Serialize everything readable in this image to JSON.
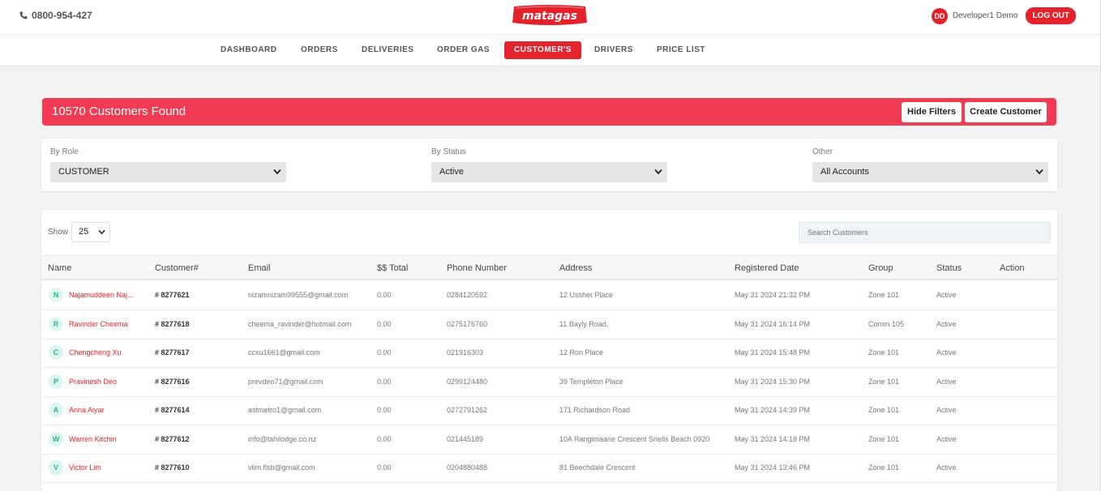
{
  "header": {
    "phone": "0800-954-427",
    "logo_text": "matagas",
    "user_initials": "DD",
    "user_name": "Developer1 Demo",
    "logout_label": "LOG OUT"
  },
  "nav": {
    "items": [
      "DASHBOARD",
      "ORDERS",
      "DELIVERIES",
      "ORDER GAS",
      "CUSTOMER'S",
      "DRIVERS",
      "PRICE LIST"
    ],
    "active": "CUSTOMER'S"
  },
  "banner": {
    "title": "10570 Customers Found",
    "hide_filters_label": "Hide Filters",
    "create_customer_label": "Create Customer"
  },
  "filters": {
    "role": {
      "label": "By Role",
      "value": "CUSTOMER"
    },
    "status": {
      "label": "By Status",
      "value": "Active"
    },
    "other": {
      "label": "Other",
      "value": "All Accounts"
    }
  },
  "table": {
    "show_label": "Show",
    "page_size": "25",
    "search_placeholder": "Search Customers",
    "columns": [
      "Name",
      "Customer#",
      "Email",
      "$$ Total",
      "Phone Number",
      "Address",
      "Registered Date",
      "Group",
      "Status",
      "Action"
    ],
    "rows": [
      {
        "initial": "N",
        "name": "Najamuddeen Naj...",
        "customer": "# 8277621",
        "email": "nizamnizam99555@gmail.com",
        "total": "0.00",
        "phone": "0284120592",
        "address": "12 Ussher Place",
        "registered": "May 31 2024 21:32 PM",
        "group": "Zone 101",
        "status": "Active"
      },
      {
        "initial": "R",
        "name": "Ravinder Cheema",
        "customer": "# 8277618",
        "email": "cheema_ravinder@hotmail.com",
        "total": "0.00",
        "phone": "0275176760",
        "address": "11 Bayly Road,",
        "registered": "May 31 2024 16:14 PM",
        "group": "Comm 105",
        "status": "Active"
      },
      {
        "initial": "C",
        "name": "Chengcheng Xu",
        "customer": "# 8277617",
        "email": "ccxu1661@gmail.com",
        "total": "0.00",
        "phone": "021916303",
        "address": "12 Ron Place",
        "registered": "May 31 2024 15:48 PM",
        "group": "Zone 101",
        "status": "Active"
      },
      {
        "initial": "P",
        "name": "Pravinesh Deo",
        "customer": "# 8277616",
        "email": "prevdeo71@gmail.com",
        "total": "0.00",
        "phone": "0299124480",
        "address": "39 Templeton Place",
        "registered": "May 31 2024 15:30 PM",
        "group": "Zone 101",
        "status": "Active"
      },
      {
        "initial": "A",
        "name": "Anna Aiyar",
        "customer": "# 8277614",
        "email": "astmetro1@gmail.com",
        "total": "0.00",
        "phone": "0272791262",
        "address": "171 Richardson Road",
        "registered": "May 31 2024 14:39 PM",
        "group": "Zone 101",
        "status": "Active"
      },
      {
        "initial": "W",
        "name": "Warren Kitchin",
        "customer": "# 8277612",
        "email": "info@tahilodge.co.nz",
        "total": "0.00",
        "phone": "021445189",
        "address": "10A Rangimaarie Crescent Snells Beach 0920",
        "registered": "May 31 2024 14:18 PM",
        "group": "Zone 101",
        "status": "Active"
      },
      {
        "initial": "V",
        "name": "Victor Lim",
        "customer": "# 8277610",
        "email": "vlim.flsb@gmail.com",
        "total": "0.00",
        "phone": "0204880488",
        "address": "81 Beechdale Crescent",
        "registered": "May 31 2024 13:46 PM",
        "group": "Zone 101",
        "status": "Active"
      }
    ]
  },
  "colors": {
    "brand_red": "#e4222b",
    "banner_red": "#f03b52",
    "avatar_teal": "#27b296"
  },
  "icons": {
    "phone": "phone-icon",
    "select": "chevron-down-icon"
  }
}
